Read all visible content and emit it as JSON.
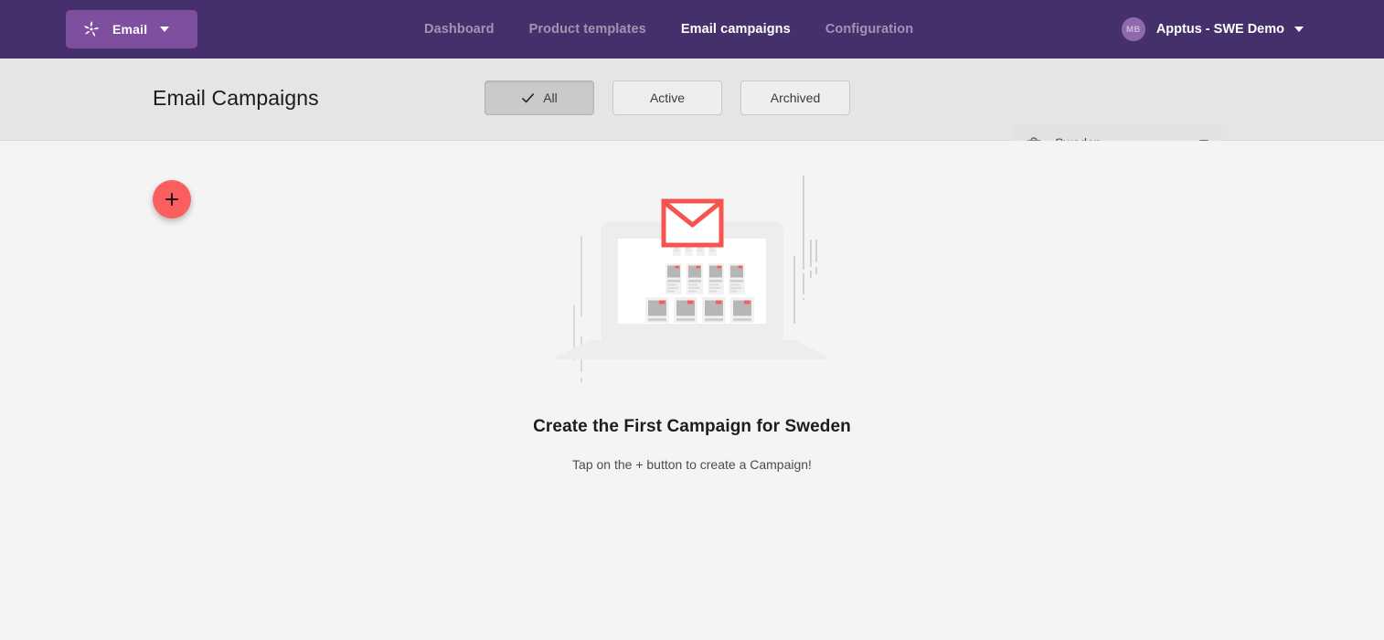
{
  "topbar": {
    "app_switcher": {
      "logo_icon": "pinwheel-logo-icon",
      "label": "Email",
      "caret_icon": "chevron-down-icon"
    },
    "nav_items": [
      {
        "label": "Dashboard",
        "active": false
      },
      {
        "label": "Product templates",
        "active": false
      },
      {
        "label": "Email campaigns",
        "active": true
      },
      {
        "label": "Configuration",
        "active": false
      }
    ],
    "account": {
      "avatar_initials": "MB",
      "name": "Apptus - SWE Demo",
      "caret_icon": "chevron-down-icon"
    },
    "bg_color": "#46306b",
    "app_switcher_color": "#7d4f9e"
  },
  "subheader": {
    "page_title": "Email Campaigns",
    "filters": [
      {
        "label": "All",
        "selected": true,
        "icon": "check-icon"
      },
      {
        "label": "Active",
        "selected": false,
        "icon": ""
      },
      {
        "label": "Archived",
        "selected": false,
        "icon": ""
      }
    ],
    "scope_select": {
      "icon": "basket-icon",
      "value": "Sweden",
      "caret_icon": "chevron-down-icon"
    },
    "add_button": {
      "icon": "plus-icon",
      "label": "",
      "color": "#fa5e5e"
    }
  },
  "empty_state": {
    "illustration": "laptop-email-campaign-illustration",
    "title": "Create the First Campaign for Sweden",
    "subtitle": "Tap on the + button to create a Campaign!"
  },
  "colors": {
    "brand_purple": "#46306b",
    "accent_red": "#fa5e5e",
    "subheader_grey": "#e5e5e5",
    "body_grey": "#f4f4f4"
  }
}
